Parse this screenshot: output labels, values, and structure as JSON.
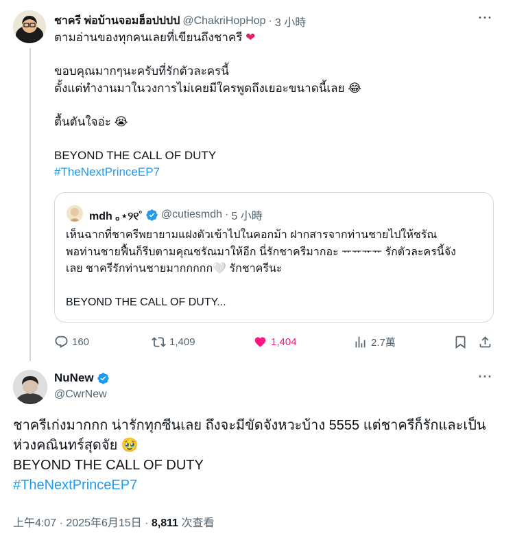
{
  "quoted_parent": {
    "author": {
      "name": "ชาครี พ่อบ้านจอมฮ็อปปปป",
      "handle": "@ChakriHopHop",
      "time": "3 小時"
    },
    "lines": [
      "ตามอ่านของทุกคนเลยที่เขียนถึงชาครี",
      "",
      "ขอบคุณมากๆนะครับที่รักตัวละครนี้",
      "ตั้งแต่ทำงานมาในวงการไม่เคยมีใครพูดถึงเยอะขนาดนี้เลย",
      "",
      "ตื้นตันใจอ่ะ",
      "",
      "BEYOND THE CALL OF DUTY"
    ],
    "emojis": {
      "heart": "❤",
      "laugh_cry": "😂",
      "sob": "😭"
    },
    "hashtag": "#TheNextPrinceEP7",
    "quote": {
      "author": {
        "name": "mdh ｡⋆୨୧˚",
        "handle": "@cutiesmdh",
        "time": "5 小時"
      },
      "lines": [
        "เห็นฉากที่ชาครีพยายามแฝงตัวเข้าไปในคอกม้า ฝากสารจากท่านชายไปให้ชรัณ",
        "พอท่านชายฟื้นก็รีบตามคุณชรัณมาให้อีก นี่รักชาครีมากอะ ᅲᅲᅲᅲ รักตัวละครนี้จัง",
        "เลย ชาครีรักท่านชายมากกกกก",
        "รักชาครีนะ",
        "",
        "BEYOND THE CALL OF DUTY..."
      ],
      "emoji_white_heart": "🤍"
    },
    "actions": {
      "replies": "160",
      "reposts": "1,409",
      "likes": "1,404",
      "views": "2.7萬"
    }
  },
  "main_tweet": {
    "author": {
      "name": "NuNew",
      "handle": "@CwrNew"
    },
    "text_line1": "ชาครีเก่งมากกก น่ารักทุกซีนเลย ถึงจะมีขัดจังหวะบ้าง 5555 แต่ชาครีก็รักและเป็น",
    "text_line2": "ห่วงคณินทร์สุดจัย",
    "emoji_pleading": "🥹",
    "text_line3": "BEYOND THE CALL OF DUTY",
    "hashtag": "#TheNextPrinceEP7",
    "meta": {
      "time": "上午4:07",
      "date": "2025年6月15日",
      "views": "8,811",
      "views_label": "次查看"
    }
  },
  "icons": [
    "more-icon",
    "verified-icon",
    "reply-icon",
    "repost-icon",
    "like-icon",
    "views-icon",
    "bookmark-icon",
    "share-icon"
  ],
  "colors": {
    "accent": "#1d9bf0",
    "like": "#f91880",
    "muted": "#536471",
    "border": "#cfd9de"
  }
}
